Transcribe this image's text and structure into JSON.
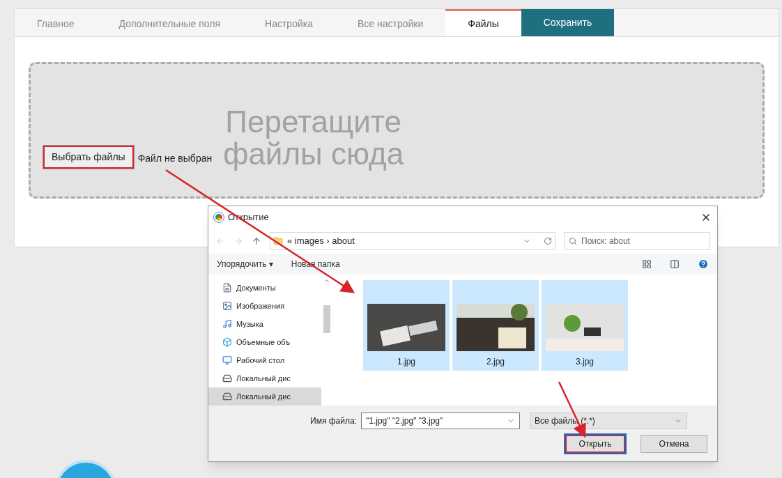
{
  "tabs": [
    {
      "label": "Главное",
      "selected": false
    },
    {
      "label": "Дополнительные поля",
      "selected": false
    },
    {
      "label": "Настройка",
      "selected": false
    },
    {
      "label": "Все настройки",
      "selected": false
    },
    {
      "label": "Файлы",
      "selected": true
    }
  ],
  "save_button": "Сохранить",
  "dropzone": {
    "hint_line_1": "Перетащите",
    "hint_line_2": "файлы сюда",
    "choose_button": "Выбрать файлы",
    "status": "Файл не выбран"
  },
  "dialog": {
    "title": "Открытие",
    "path": "« images › about",
    "search": {
      "placeholder": "Поиск: about"
    },
    "toolbar": [
      "Упорядочить ▾",
      "Новая папка"
    ],
    "sidebar": [
      {
        "label": "Документы",
        "kind": "documents",
        "selected": false
      },
      {
        "label": "Изображения",
        "kind": "pictures",
        "selected": false
      },
      {
        "label": "Музыка",
        "kind": "music",
        "selected": false
      },
      {
        "label": "Объемные объ",
        "kind": "objects",
        "selected": false
      },
      {
        "label": "Рабочий стол",
        "kind": "desktop",
        "selected": false
      },
      {
        "label": "Локальный дис",
        "kind": "drive",
        "selected": false
      },
      {
        "label": "Локальный дис",
        "kind": "drive",
        "selected": true
      }
    ],
    "files": [
      {
        "name": "1.jpg",
        "selected": true
      },
      {
        "name": "2.jpg",
        "selected": true
      },
      {
        "name": "3.jpg",
        "selected": true
      }
    ],
    "filename_label": "Имя файла:",
    "filename": "\"1.jpg\" \"2.jpg\" \"3.jpg\"",
    "filter": "Все файлы (*.*)",
    "buttons": [
      "Открыть",
      "Отмена"
    ]
  }
}
